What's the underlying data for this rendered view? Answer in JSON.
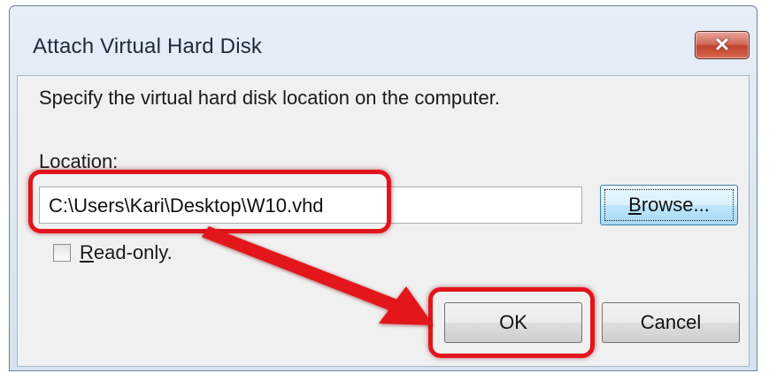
{
  "window": {
    "title": "Attach Virtual Hard Disk",
    "close_glyph": "✕"
  },
  "dialog": {
    "instruction": "Specify the virtual hard disk location on the computer.",
    "location_label": "Location:",
    "location_value": "C:\\Users\\Kari\\Desktop\\W10.vhd",
    "browse_label_mnemonic": "B",
    "browse_label_rest": "rowse...",
    "readonly_label_mnemonic": "R",
    "readonly_label_rest": "ead-only.",
    "readonly_checked": false,
    "ok_label": "OK",
    "cancel_label": "Cancel"
  },
  "annotation": {
    "highlight_color": "#e3141b"
  },
  "icons": {
    "close": "close-icon"
  }
}
